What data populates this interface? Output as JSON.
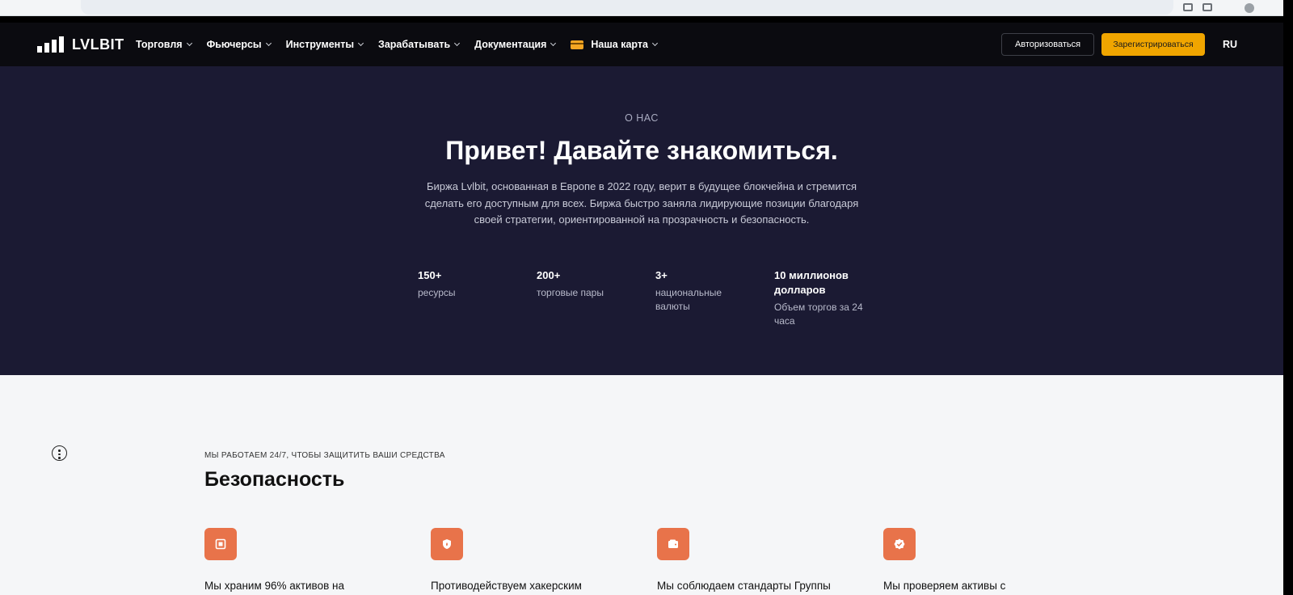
{
  "nav": {
    "logo_text": "LVLBIT",
    "items": [
      {
        "label": "Торговля"
      },
      {
        "label": "Фьючерсы"
      },
      {
        "label": "Инструменты"
      },
      {
        "label": "Зарабатывать"
      },
      {
        "label": "Документация"
      },
      {
        "label": "Наша карта",
        "icon": "card-icon"
      }
    ],
    "login_label": "Авторизоваться",
    "register_label": "Зарегистрироваться",
    "lang": "RU"
  },
  "hero": {
    "eyebrow": "О НАС",
    "title": "Привет! Давайте знакомиться.",
    "description": "Биржа Lvlbit, основанная в Европе в 2022 году, верит в будущее блокчейна и стремится сделать его доступным для всех. Биржа быстро заняла лидирующие позиции благодаря своей стратегии, ориентированной на прозрачность и безопасность.",
    "stats": [
      {
        "value": "150+",
        "label": "ресурсы"
      },
      {
        "value": "200+",
        "label": "торговые пары"
      },
      {
        "value": "3+",
        "label": "национальные валюты"
      },
      {
        "value": "10 миллионов долларов",
        "label": "Объем торгов за 24 часа"
      }
    ]
  },
  "security": {
    "eyebrow": "МЫ РАБОТАЕМ 24/7, ЧТОБЫ ЗАЩИТИТЬ ВАШИ СРЕДСТВА",
    "title": "Безопасность",
    "features": [
      {
        "icon": "vault-icon",
        "text": "Мы храним 96% активов на"
      },
      {
        "icon": "shield-fire-icon",
        "text": "Противодействуем хакерским"
      },
      {
        "icon": "wallet-icon",
        "text": "Мы соблюдаем стандарты Группы"
      },
      {
        "icon": "check-badge-icon",
        "text": "Мы проверяем активы с"
      }
    ]
  },
  "colors": {
    "nav_bg": "#0b0b10",
    "hero_bg": "#1b1a33",
    "accent": "#f0a500",
    "feature_icon_bg": "#e8734a"
  }
}
